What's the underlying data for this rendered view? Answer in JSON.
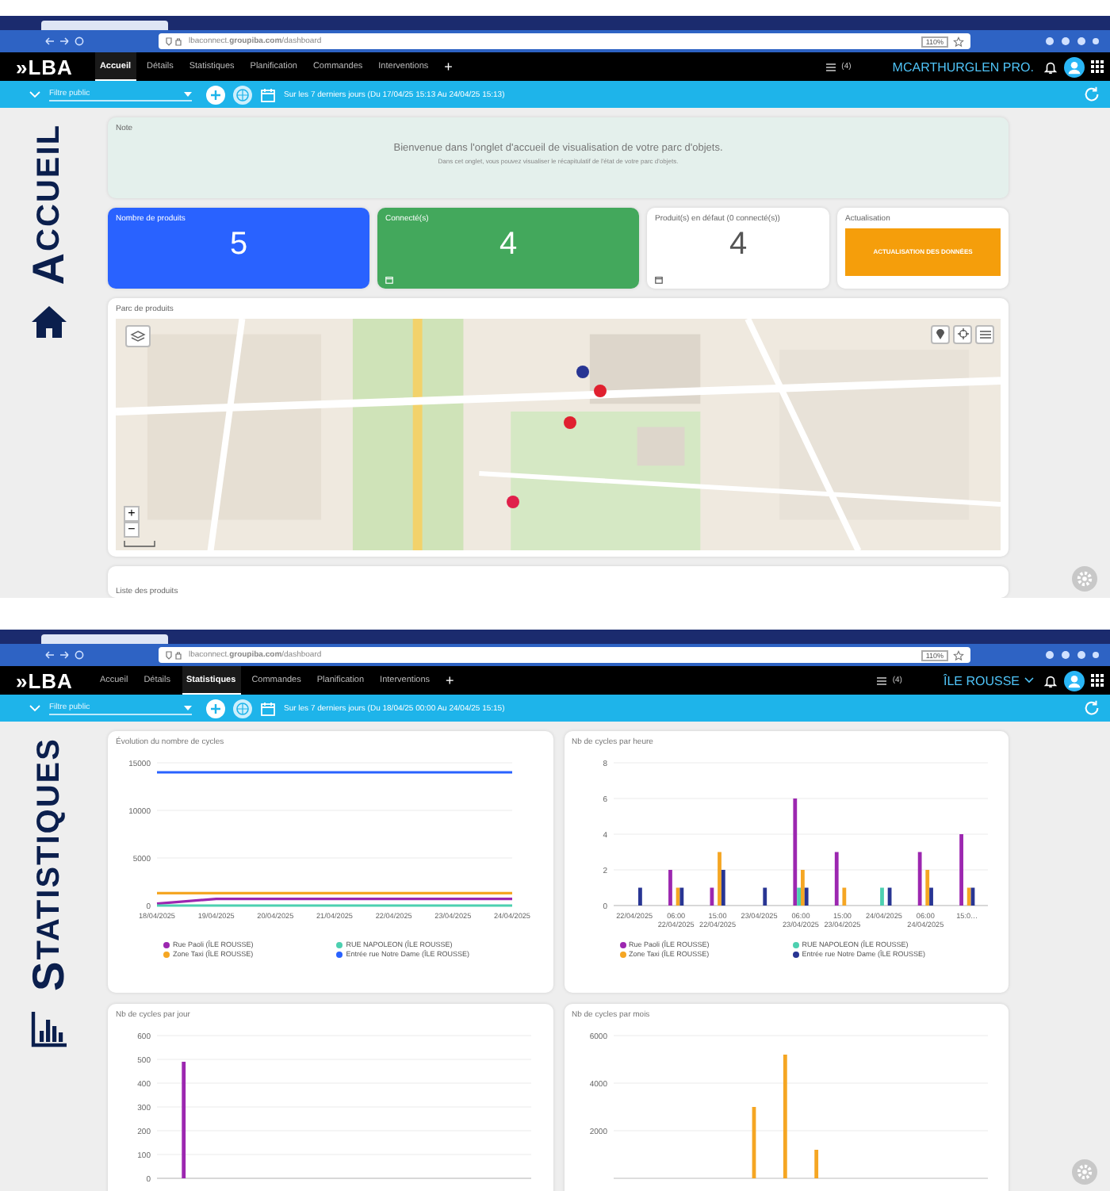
{
  "screens": [
    {
      "kind": "home",
      "browser": {
        "url": "lbaconnect.**groupiba.com**/dashboard",
        "zoom": "110%"
      },
      "nav": {
        "logo": "»LBA",
        "tabs": [
          {
            "label": "Accueil",
            "selected": true
          },
          {
            "label": "Détails",
            "selected": false
          },
          {
            "label": "Statistiques",
            "selected": false
          },
          {
            "label": "Planification",
            "selected": false
          },
          {
            "label": "Commandes",
            "selected": false
          },
          {
            "label": "Interventions",
            "selected": false
          }
        ],
        "add": "+",
        "queue": "(4)",
        "account": "MCARTHURGLEN PRO."
      },
      "filter": {
        "value": "Filtre public",
        "period": "Sur les 7 derniers jours (Du 17/04/25 15:13 Au 24/04/25 15:13)"
      },
      "page_label": "ACCUEIL",
      "note": {
        "title": "Note",
        "headline": "Bienvenue dans l'onglet d'accueil de visualisation de votre parc d'objets.",
        "text": "Dans cet onglet, vous pouvez visualiser le récapitulatif de l'état de votre parc d'objets."
      },
      "stats": [
        {
          "kind": "blue",
          "label": "Nombre de produits",
          "value": "5"
        },
        {
          "kind": "green",
          "label": "Connecté(s)",
          "value": "4"
        },
        {
          "kind": "plain",
          "label": "Produit(s) en défaut (0 connecté(s))",
          "value": "4"
        }
      ],
      "refresh": {
        "label": "Actualisation",
        "button": "ACTUALISATION DES DONNÉES"
      },
      "map": {
        "title": "Parc de produits",
        "zoom_in": "+",
        "zoom_out": "−"
      },
      "list": {
        "title": "Liste des produits"
      }
    },
    {
      "kind": "statistics",
      "browser": {
        "url": "lbaconnect.**groupiba.com**/dashboard",
        "zoom": "110%"
      },
      "nav": {
        "logo": "»LBA",
        "tabs": [
          {
            "label": "Accueil",
            "selected": false
          },
          {
            "label": "Détails",
            "selected": false
          },
          {
            "label": "Statistiques",
            "selected": true
          },
          {
            "label": "Commandes",
            "selected": false
          },
          {
            "label": "Planification",
            "selected": false
          },
          {
            "label": "Interventions",
            "selected": false
          }
        ],
        "add": "+",
        "queue": "(4)",
        "account": "ÎLE ROUSSE"
      },
      "filter": {
        "value": "Filtre public",
        "period": "Sur les 7 derniers jours (Du 18/04/25 00:00 Au 24/04/25 15:15)"
      },
      "page_label": "STATISTIQUES",
      "charts": [
        {
          "chart_data": {
            "type": "line",
            "title": "Évolution du nombre de cycles",
            "grid": true,
            "categories": [
              "18/04/2025",
              "19/04/2025",
              "20/04/2025",
              "21/04/2025",
              "22/04/2025",
              "23/04/2025",
              "24/04/2025"
            ],
            "ylim": [
              0,
              15000
            ],
            "yticks": [
              0,
              5000,
              10000,
              15000
            ],
            "series": [
              {
                "name": "Rue Paoli (ÎLE ROUSSE)",
                "color": "#9c27b0",
                "values": [
                  200,
                  700,
                  700,
                  700,
                  700,
                  700,
                  700
                ]
              },
              {
                "name": "RUE NAPOLEON (ÎLE ROUSSE)",
                "color": "#4dd0b0",
                "values": [
                  0,
                  0,
                  0,
                  0,
                  0,
                  0,
                  0
                ]
              },
              {
                "name": "Zone Taxi (ÎLE ROUSSE)",
                "color": "#f5a623",
                "values": [
                  1300,
                  1300,
                  1300,
                  1300,
                  1300,
                  1300,
                  1300
                ]
              },
              {
                "name": "Entrée rue Notre Dame (ÎLE ROUSSE)",
                "color": "#2962ff",
                "values": [
                  14000,
                  14000,
                  14000,
                  14000,
                  14000,
                  14000,
                  14000
                ]
              }
            ]
          }
        },
        {
          "chart_data": {
            "type": "bar",
            "title": "Nb de cycles par heure",
            "grid": true,
            "categories": [
              "22/04/2025",
              "06:00 22/04/2025",
              "15:00 22/04/2025",
              "23/04/2025",
              "06:00 23/04/2025",
              "15:00 23/04/2025",
              "24/04/2025",
              "06:00 24/04/2025",
              "15:0…"
            ],
            "ylim": [
              0,
              8
            ],
            "yticks": [
              0,
              2,
              4,
              6,
              8
            ],
            "series": [
              {
                "name": "Rue Paoli (ÎLE ROUSSE)",
                "color": "#9c27b0",
                "values": [
                  0,
                  2,
                  1,
                  0,
                  6,
                  3,
                  0,
                  3,
                  4
                ]
              },
              {
                "name": "RUE NAPOLEON (ÎLE ROUSSE)",
                "color": "#4dd0b0",
                "values": [
                  0,
                  0,
                  0,
                  0,
                  1,
                  0,
                  1,
                  0,
                  0
                ]
              },
              {
                "name": "Zone Taxi (ÎLE ROUSSE)",
                "color": "#f5a623",
                "values": [
                  0,
                  1,
                  3,
                  0,
                  2,
                  1,
                  0,
                  2,
                  1
                ]
              },
              {
                "name": "Entrée rue Notre Dame (ÎLE ROUSSE)",
                "color": "#283593",
                "values": [
                  1,
                  1,
                  2,
                  1,
                  1,
                  0,
                  1,
                  1,
                  1
                ]
              }
            ]
          }
        },
        {
          "chart_data": {
            "type": "bar",
            "title": "Nb de cycles par jour",
            "grid": true,
            "ylim": [
              0,
              600
            ],
            "yticks": [
              0,
              100,
              200,
              300,
              400,
              500,
              600
            ],
            "series": [
              {
                "color": "#9c27b0",
                "values": [
                  490,
                  0,
                  0,
                  0,
                  0,
                  0,
                  0
                ]
              }
            ]
          }
        },
        {
          "chart_data": {
            "type": "bar",
            "title": "Nb de cycles par mois",
            "grid": true,
            "ylim": [
              0,
              6000
            ],
            "yticks": [
              2000,
              4000,
              6000
            ],
            "series": [
              {
                "color": "#f5a623",
                "values": [
                  0,
                  0,
                  0,
                  0,
                  3000,
                  5200,
                  1200,
                  0,
                  0,
                  0,
                  0,
                  0
                ]
              }
            ]
          }
        }
      ]
    }
  ]
}
